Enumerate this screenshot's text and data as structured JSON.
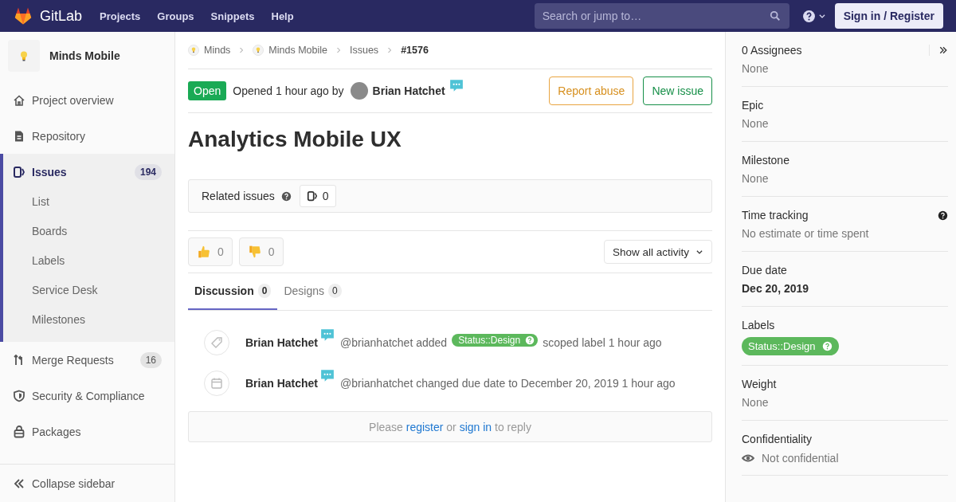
{
  "topbar": {
    "brand": "GitLab",
    "nav": [
      "Projects",
      "Groups",
      "Snippets",
      "Help"
    ],
    "search": {
      "placeholder": "Search or jump to…"
    },
    "sign_in": "Sign in / Register"
  },
  "sidebar": {
    "project": "Minds Mobile",
    "items": [
      {
        "label": "Project overview",
        "kind": "home",
        "selected": false
      },
      {
        "label": "Repository",
        "kind": "doc",
        "selected": false
      },
      {
        "label": "Issues",
        "kind": "issues",
        "count": "194",
        "selected": true,
        "children": [
          {
            "label": "List"
          },
          {
            "label": "Boards"
          },
          {
            "label": "Labels"
          },
          {
            "label": "Service Desk"
          },
          {
            "label": "Milestones"
          }
        ]
      },
      {
        "label": "Merge Requests",
        "kind": "merge",
        "count": "16",
        "selected": false
      },
      {
        "label": "Security & Compliance",
        "kind": "shield",
        "selected": false
      },
      {
        "label": "Packages",
        "kind": "package",
        "selected": false
      }
    ],
    "collapse": "Collapse sidebar"
  },
  "breadcrumbs": [
    {
      "label": "Minds",
      "avatar": true,
      "current": false
    },
    {
      "label": "Minds Mobile",
      "avatar": true,
      "current": false
    },
    {
      "label": "Issues",
      "avatar": false,
      "current": false
    },
    {
      "label": "#1576",
      "avatar": false,
      "current": true
    }
  ],
  "issue": {
    "status": "Open",
    "opened": "Opened 1 hour ago by",
    "author": "Brian Hatchet",
    "buttons": [
      {
        "label": "Report abuse",
        "kind": "warning"
      },
      {
        "label": "New issue",
        "kind": "success"
      }
    ],
    "title": "Analytics Mobile UX"
  },
  "related": {
    "label": "Related issues",
    "count": "0"
  },
  "awards": [
    {
      "kind": "thumbsup",
      "count": "0"
    },
    {
      "kind": "thumbsdown",
      "count": "0"
    }
  ],
  "activity_filter": "Show all activity",
  "tabs": [
    {
      "label": "Discussion",
      "count": "0",
      "selected": true
    },
    {
      "label": "Designs",
      "count": "0",
      "selected": false
    }
  ],
  "notes": [
    {
      "kind": "tag",
      "author": "Brian Hatchet",
      "text": "@brianhatchet added",
      "label": "Status::Design",
      "after": "scoped label 1 hour ago"
    },
    {
      "kind": "calendar",
      "author": "Brian Hatchet",
      "text": "@brianhatchet changed due date to December 20, 2019 1 hour ago"
    }
  ],
  "reply": {
    "before": "Please",
    "register_link": "register",
    "middle": "or",
    "sign_in_link": "sign in",
    "after": "to reply"
  },
  "right_sidebar": [
    {
      "title": "0 Assignees",
      "kind": "text",
      "value": "None",
      "collapse": true
    },
    {
      "title": "Epic",
      "kind": "text",
      "value": "None"
    },
    {
      "title": "Milestone",
      "kind": "text",
      "value": "None"
    },
    {
      "title": "Time tracking",
      "kind": "text",
      "value": "No estimate or time spent",
      "help": true
    },
    {
      "title": "Due date",
      "kind": "bold",
      "value": "Dec 20, 2019"
    },
    {
      "title": "Labels",
      "kind": "label",
      "value": "Status::Design"
    },
    {
      "title": "Weight",
      "kind": "text",
      "value": "None"
    },
    {
      "title": "Confidentiality",
      "kind": "eye",
      "value": "Not confidential"
    }
  ]
}
